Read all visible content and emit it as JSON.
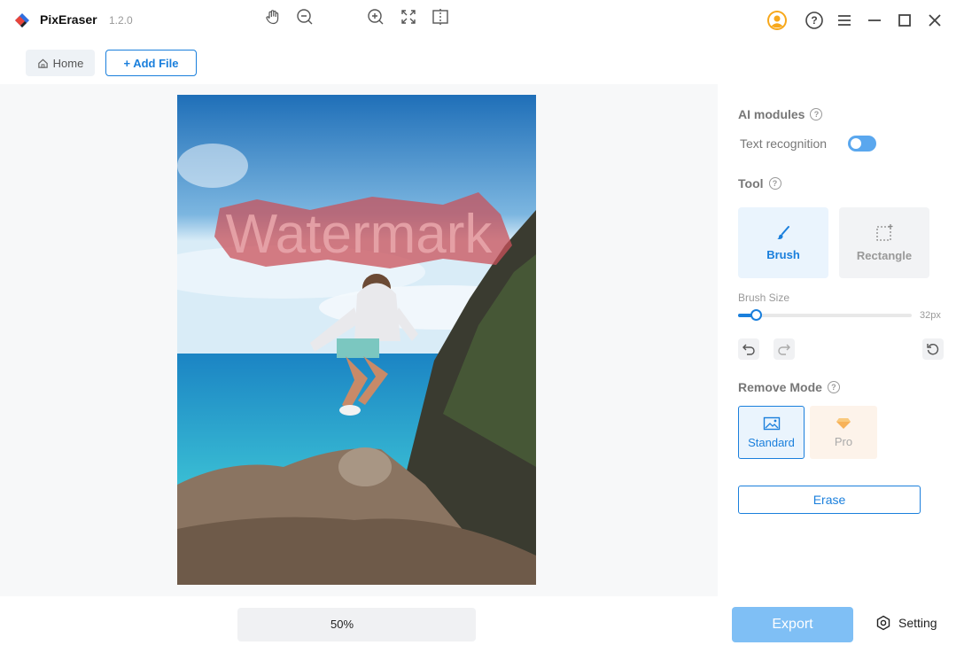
{
  "app": {
    "name": "PixEraser",
    "version": "1.2.0"
  },
  "toolbar": {
    "home_label": "Home",
    "add_file_label": "+ Add File"
  },
  "canvas": {
    "watermark_text": "Watermark",
    "zoom_level": "50%"
  },
  "panel": {
    "ai_modules_title": "AI modules",
    "text_recognition_label": "Text recognition",
    "text_recognition_enabled": true,
    "tool_title": "Tool",
    "tools": [
      {
        "label": "Brush",
        "selected": true
      },
      {
        "label": "Rectangle",
        "selected": false
      }
    ],
    "brush_size_label": "Brush Size",
    "brush_size_value": "32px",
    "brush_size_fraction": 0.1,
    "remove_mode_title": "Remove Mode",
    "modes": [
      {
        "label": "Standard",
        "selected": true
      },
      {
        "label": "Pro",
        "selected": false
      }
    ],
    "erase_label": "Erase"
  },
  "footer": {
    "export_label": "Export",
    "setting_label": "Setting"
  },
  "colors": {
    "accent": "#1a7fdc",
    "export_disabled": "#7fbff5",
    "watermark_highlight": "#c9525a"
  },
  "icons": [
    "logo-icon",
    "account-icon",
    "help-icon",
    "menu-icon",
    "minimize-icon",
    "maximize-icon",
    "close-icon",
    "home-icon",
    "hand-icon",
    "zoom-out-icon",
    "zoom-in-icon",
    "fit-screen-icon",
    "compare-icon",
    "brush-icon",
    "rectangle-select-icon",
    "undo-icon",
    "redo-icon",
    "reset-icon",
    "image-icon",
    "diamond-icon",
    "gear-icon"
  ]
}
